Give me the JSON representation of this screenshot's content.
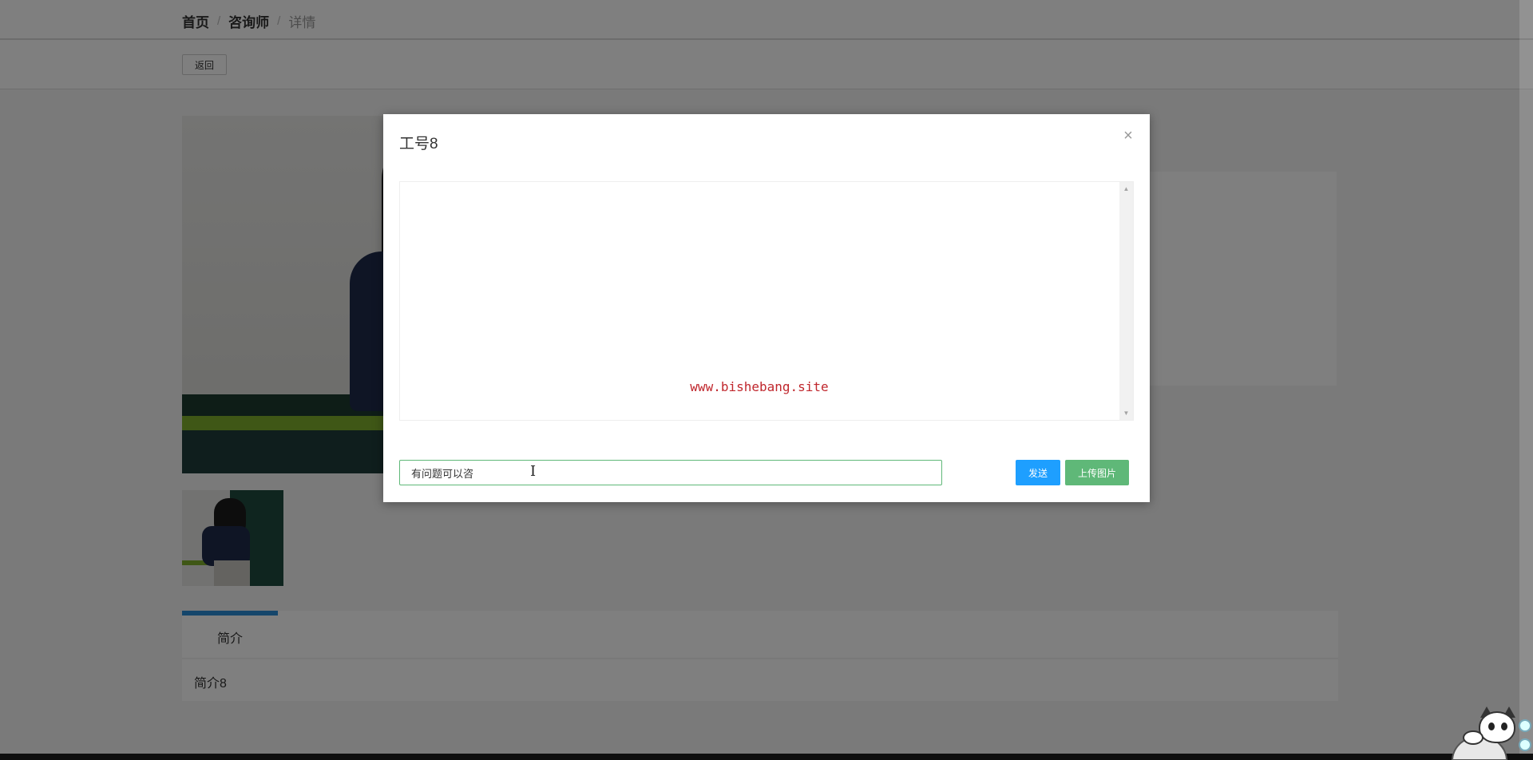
{
  "breadcrumb": {
    "items": [
      "首页",
      "咨询师",
      "详情"
    ],
    "separator": "/"
  },
  "toolbar": {
    "back_label": "返回"
  },
  "tabs": {
    "active_label": "简介",
    "content": "简介8"
  },
  "modal": {
    "title": "工号8",
    "close_glyph": "×",
    "watermark": "www.bishebang.site",
    "input_value": "有问题可以咨",
    "send_label": "发送",
    "upload_label": "上传图片"
  },
  "colors": {
    "accent_blue": "#1e9fff",
    "accent_green": "#5fb878",
    "watermark_red": "#c0272d",
    "tab_blue": "#2b8cd6"
  }
}
